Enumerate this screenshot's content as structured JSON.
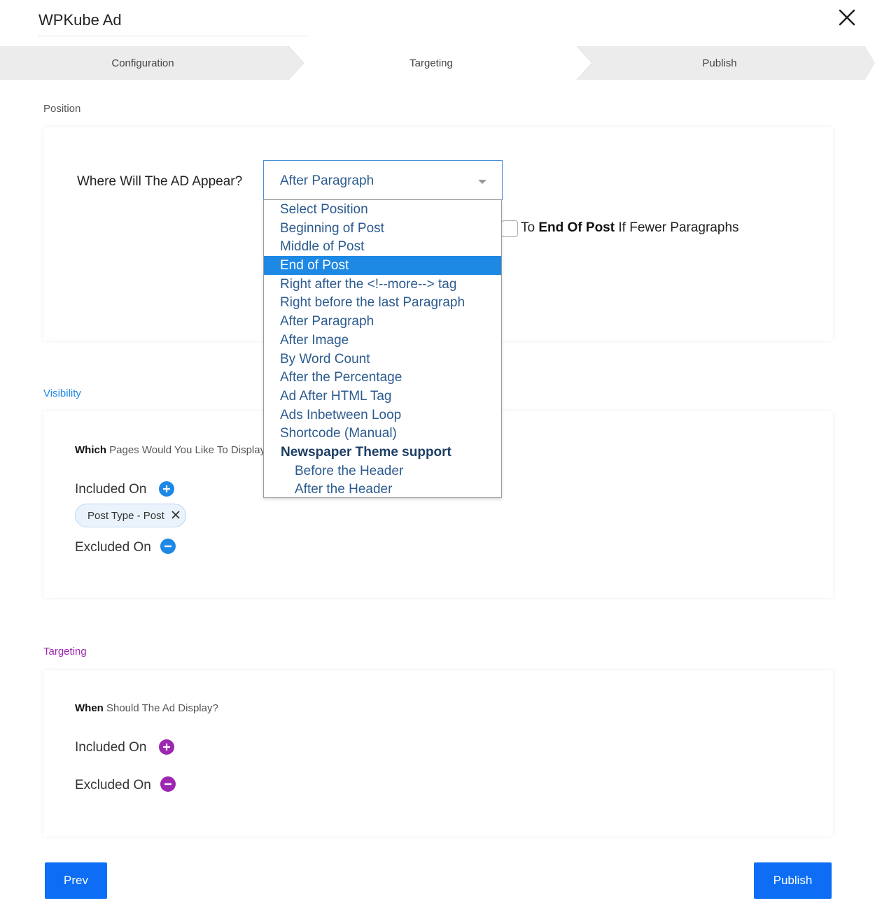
{
  "header": {
    "title": "WPKube Ad"
  },
  "steps": [
    {
      "label": "Configuration"
    },
    {
      "label": "Targeting"
    },
    {
      "label": "Publish"
    }
  ],
  "position": {
    "section_title": "Position",
    "question": "Where Will The AD Appear?",
    "selected_value": "After Paragraph",
    "options": [
      "Select Position",
      "Beginning of Post",
      "Middle of Post",
      "End of Post",
      "Right after the <!--more--> tag",
      "Right before the last Paragraph",
      "After Paragraph",
      "After Image",
      "By Word Count",
      "After the Percentage",
      "Ad After HTML Tag",
      "Ads Inbetween Loop",
      "Shortcode (Manual)"
    ],
    "highlighted_option": "End of Post",
    "group_label": "Newspaper Theme support",
    "group_options": [
      "Before the Header",
      "After the Header"
    ],
    "fallback": {
      "prefix": "To ",
      "bold": "End Of Post",
      "suffix": " If Fewer Paragraphs"
    }
  },
  "visibility": {
    "section_title": "Visibility",
    "question_bold": "Which",
    "question_rest": " Pages Would You Like To Display",
    "included_label": "Included On",
    "excluded_label": "Excluded On",
    "chips": [
      {
        "label": "Post Type - Post"
      }
    ]
  },
  "targeting": {
    "section_title": "Targeting",
    "question_bold": "When",
    "question_rest": " Should The Ad Display?",
    "included_label": "Included On",
    "excluded_label": "Excluded On"
  },
  "footer": {
    "prev_label": "Prev",
    "publish_label": "Publish"
  },
  "colors": {
    "blue_accent": "#1e88e5",
    "purple_accent": "#9c27b0",
    "button_blue": "#0d6ef5"
  }
}
